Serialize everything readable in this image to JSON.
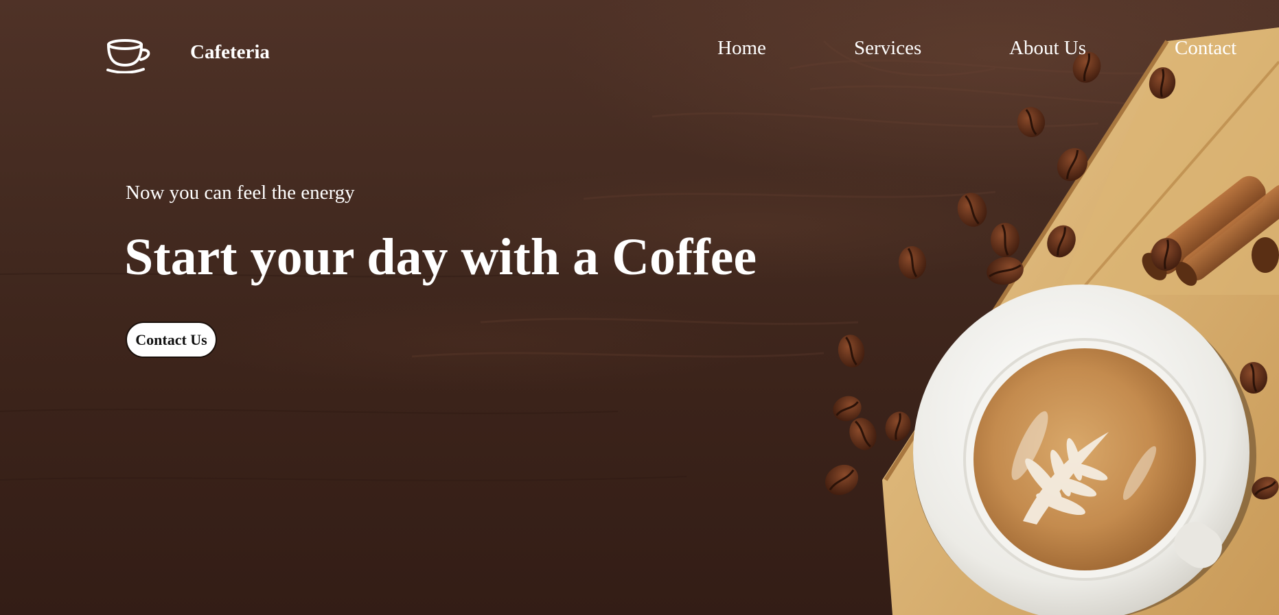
{
  "header": {
    "brand": "Cafeteria",
    "logo_icon": "coffee-cup-icon",
    "nav": [
      {
        "label": "Home"
      },
      {
        "label": "Services"
      },
      {
        "label": "About Us"
      },
      {
        "label": "Contact"
      }
    ]
  },
  "hero": {
    "tagline": "Now you can feel the energy",
    "headline": "Start your day with a Coffee",
    "cta_label": "Contact Us",
    "image": "coffee-latte-art-with-beans-and-cinnamon"
  },
  "colors": {
    "background": "#3a2119",
    "text": "#ffffff",
    "button_bg": "#ffffff",
    "button_text": "#111111"
  }
}
